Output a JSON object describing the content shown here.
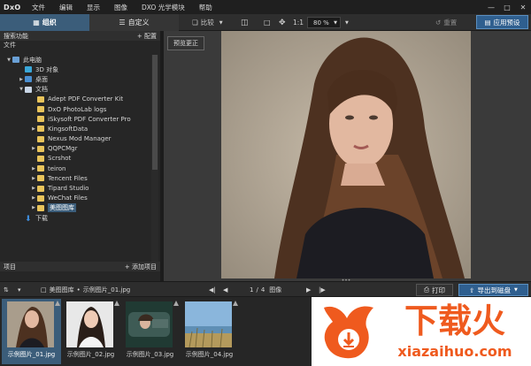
{
  "menubar": {
    "logo": "DxO",
    "items": [
      "文件",
      "编辑",
      "显示",
      "图像",
      "DXO 光学模块",
      "帮助"
    ]
  },
  "toolbar": {
    "tab_organize": "组织",
    "tab_customize": "自定义",
    "compare": "比较",
    "ratio": "1:1",
    "zoom": "80 %",
    "reset": "重置",
    "apply_preset": "应用预设"
  },
  "left_panel": {
    "search_title": "搜索功能",
    "search_action": "+ 配置",
    "folder_label": "文件",
    "tree": [
      {
        "label": "此电脑",
        "icon": "computer-icon",
        "depth": 1,
        "chevron": "down"
      },
      {
        "label": "3D 对象",
        "icon": "cube-icon",
        "depth": 2,
        "chevron": ""
      },
      {
        "label": "桌面",
        "icon": "desktop-icon",
        "depth": 2,
        "chevron": "right"
      },
      {
        "label": "文档",
        "icon": "document-icon",
        "depth": 2,
        "chevron": "down"
      },
      {
        "label": "Adept PDF Converter Kit",
        "icon": "folder-icon",
        "depth": 3,
        "chevron": ""
      },
      {
        "label": "DxO PhotoLab logs",
        "icon": "folder-icon",
        "depth": 3,
        "chevron": ""
      },
      {
        "label": "iSkysoft PDF Converter Pro",
        "icon": "folder-icon",
        "depth": 3,
        "chevron": ""
      },
      {
        "label": "KingsoftData",
        "icon": "folder-icon",
        "depth": 3,
        "chevron": "right"
      },
      {
        "label": "Nexus Mod Manager",
        "icon": "folder-icon",
        "depth": 3,
        "chevron": ""
      },
      {
        "label": "QQPCMgr",
        "icon": "folder-icon",
        "depth": 3,
        "chevron": "right"
      },
      {
        "label": "Scrshot",
        "icon": "folder-icon",
        "depth": 3,
        "chevron": ""
      },
      {
        "label": "teiron",
        "icon": "folder-icon",
        "depth": 3,
        "chevron": "right"
      },
      {
        "label": "Tencent Files",
        "icon": "folder-icon",
        "depth": 3,
        "chevron": "right"
      },
      {
        "label": "Tipard Studio",
        "icon": "folder-icon",
        "depth": 3,
        "chevron": "right"
      },
      {
        "label": "WeChat Files",
        "icon": "folder-icon",
        "depth": 3,
        "chevron": "right"
      },
      {
        "label": "美图图库",
        "icon": "folder-icon",
        "depth": 3,
        "chevron": "right",
        "selected": true
      },
      {
        "label": "下载",
        "icon": "download-icon",
        "depth": 2,
        "chevron": ""
      }
    ],
    "projects_title": "项目",
    "projects_action": "+ 添加项目"
  },
  "viewer": {
    "compare_button": "预览更正"
  },
  "filmbar": {
    "path_folder": "美图图库",
    "path_file": "示例图片_01.jpg",
    "page_current": "1",
    "page_separator": "/",
    "page_total": "4",
    "page_unit": "图像",
    "print": "打印",
    "export": "导出到磁盘"
  },
  "filmstrip": [
    {
      "caption": "示例图片_01.jpg",
      "selected": true
    },
    {
      "caption": "示例图片_02.jpg",
      "selected": false
    },
    {
      "caption": "示例图片_03.jpg",
      "selected": false
    },
    {
      "caption": "示例图片_04.jpg",
      "selected": false
    }
  ],
  "watermark": {
    "main_text": "下载火",
    "url_text": "xiazaihuo.com"
  },
  "colors": {
    "accent_blue": "#3b5d7a",
    "button_blue": "#2f5f8f",
    "folder_yellow": "#e9c45b",
    "brand_orange": "#ef5a1e"
  }
}
